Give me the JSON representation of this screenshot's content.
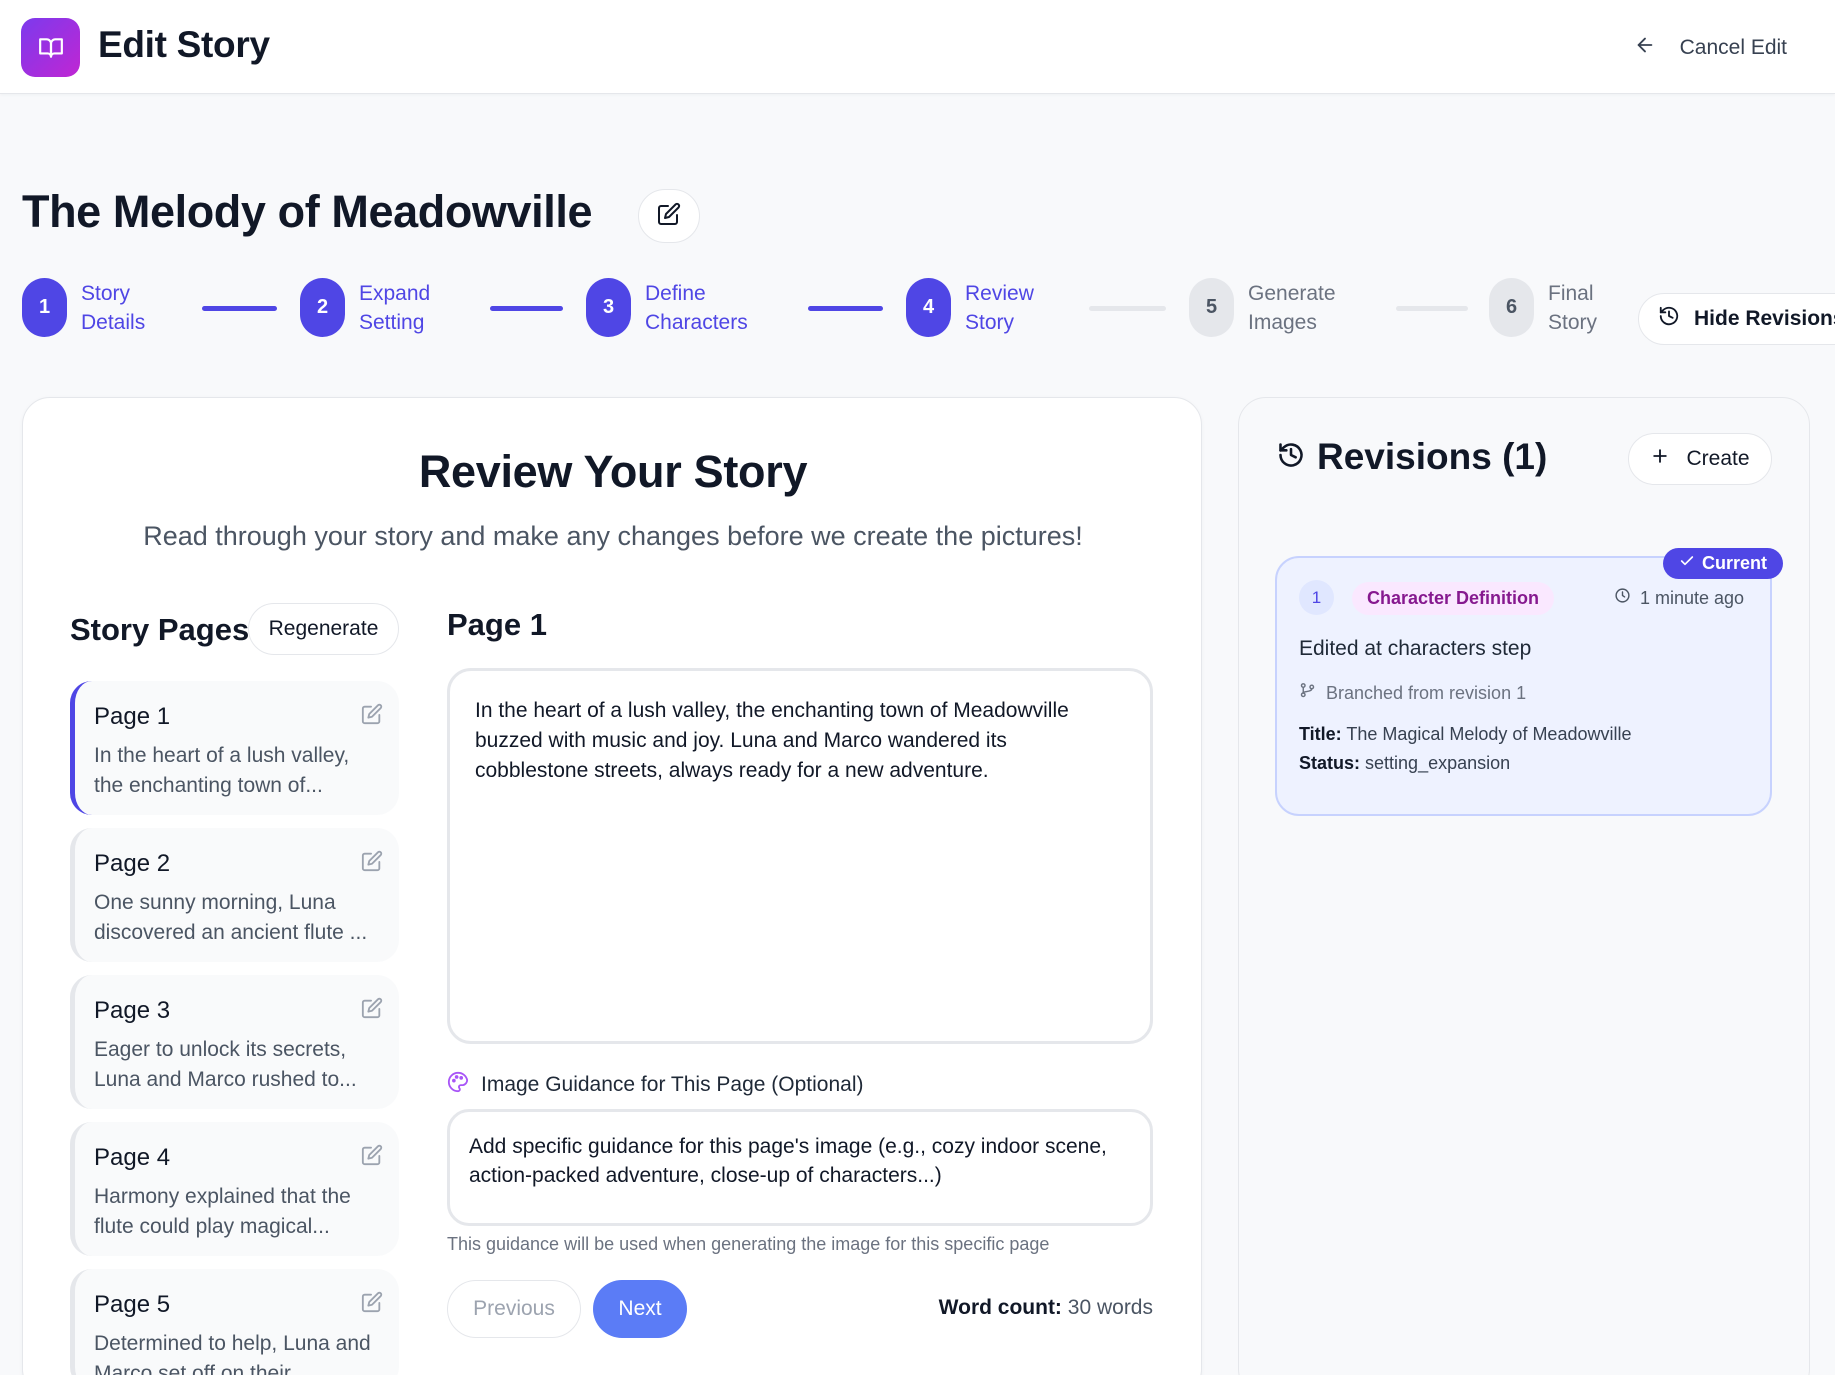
{
  "header": {
    "app_title": "Edit Story",
    "logo_icon": "book-open-icon",
    "cancel_label": "Cancel Edit"
  },
  "story": {
    "title": "The Melody of Meadowville"
  },
  "stepper": {
    "steps": [
      {
        "number": "1",
        "line1": "Story",
        "line2": "Details",
        "state": "completed"
      },
      {
        "number": "2",
        "line1": "Expand",
        "line2": "Setting",
        "state": "completed"
      },
      {
        "number": "3",
        "line1": "Define",
        "line2": "Characters",
        "state": "completed"
      },
      {
        "number": "4",
        "line1": "Review",
        "line2": "Story",
        "state": "current"
      },
      {
        "number": "5",
        "line1": "Generate",
        "line2": "Images",
        "state": "pending"
      },
      {
        "number": "6",
        "line1": "Final",
        "line2": "Story",
        "state": "pending"
      }
    ],
    "hide_revisions_label": "Hide Revisions"
  },
  "review": {
    "title": "Review Your Story",
    "subtitle": "Read through your story and make any changes before we create the pictures!",
    "pages_heading": "Story Pages",
    "regenerate_label": "Regenerate",
    "pages": [
      {
        "title": "Page 1",
        "excerpt": "In the heart of a lush valley, the enchanting town of..."
      },
      {
        "title": "Page 2",
        "excerpt": "One sunny morning, Luna discovered an ancient flute ..."
      },
      {
        "title": "Page 3",
        "excerpt": "Eager to unlock its secrets, Luna and Marco rushed to..."
      },
      {
        "title": "Page 4",
        "excerpt": "Harmony explained that the flute could play magical..."
      },
      {
        "title": "Page 5",
        "excerpt": "Determined to help, Luna and Marco set off on their"
      }
    ],
    "current_page_heading": "Page 1",
    "current_page_text": "In the heart of a lush valley, the enchanting town of Meadowville buzzed with music and joy. Luna and Marco wandered its cobblestone streets, always ready for a new adventure.",
    "guidance_label": "Image Guidance for This Page (Optional)",
    "guidance_placeholder": "Add specific guidance for this page's image (e.g., cozy indoor scene, action-packed adventure, close-up of characters...)",
    "guidance_help": "This guidance will be used when generating the image for this specific page",
    "previous_label": "Previous",
    "next_label": "Next",
    "word_count_label": "Word count:",
    "word_count_value": "30 words"
  },
  "revisions": {
    "heading": "Revisions (1)",
    "create_label": "Create",
    "items": [
      {
        "badge": "Current",
        "number": "1",
        "type": "Character Definition",
        "time": "1 minute ago",
        "description": "Edited at characters step",
        "branch": "Branched from revision 1",
        "title_label": "Title:",
        "title_value": "The Magical Melody of Meadowville",
        "status_label": "Status:",
        "status_value": "setting_expansion"
      }
    ]
  },
  "colors": {
    "accent": "#4f46e5",
    "next_button": "#5b7cf6",
    "type_badge_bg": "#fae8ff",
    "type_badge_text": "#86198f"
  }
}
